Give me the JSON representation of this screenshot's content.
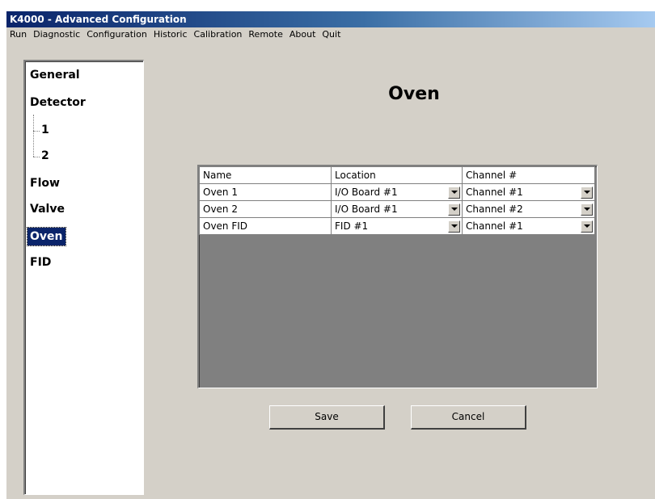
{
  "window": {
    "title": "K4000 - Advanced Configuration"
  },
  "menu": [
    "Run",
    "Diagnostic",
    "Configuration",
    "Historic",
    "Calibration",
    "Remote",
    "About",
    "Quit"
  ],
  "sidebar": {
    "items": [
      "General",
      "Detector",
      "1",
      "2",
      "Flow",
      "Valve",
      "Oven",
      "FID"
    ],
    "selected": "Oven"
  },
  "page": {
    "title": "Oven"
  },
  "table": {
    "headers": [
      "Name",
      "Location",
      "Channel #"
    ],
    "rows": [
      {
        "name": "Oven 1",
        "location": "I/O Board #1",
        "channel": "Channel #1"
      },
      {
        "name": "Oven 2",
        "location": "I/O Board #1",
        "channel": "Channel #2"
      },
      {
        "name": "Oven FID",
        "location": "FID #1",
        "channel": "Channel #1"
      }
    ]
  },
  "buttons": {
    "save": "Save",
    "cancel": "Cancel"
  },
  "colors": {
    "titlebar": "#0a246a",
    "selection": "#0a246a",
    "face": "#d4d0c8",
    "grid_empty": "#808080"
  },
  "icons": {
    "dropdown": "dropdown-arrow-icon"
  }
}
